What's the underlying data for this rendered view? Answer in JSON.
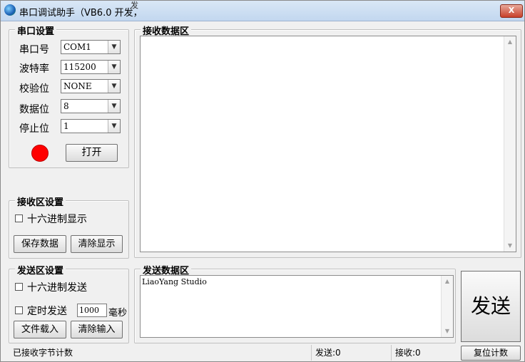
{
  "window": {
    "title": "串口调试助手（VB6.0 开发，",
    "title_extra": "发",
    "close_label": "X"
  },
  "serial_settings": {
    "legend": "串口设置",
    "port_label": "串口号",
    "port_value": "COM1",
    "baud_label": "波特率",
    "baud_value": "115200",
    "parity_label": "校验位",
    "parity_value": "NONE",
    "databits_label": "数据位",
    "databits_value": "8",
    "stopbits_label": "停止位",
    "stopbits_value": "1",
    "status_color": "#ff0000",
    "open_label": "打开"
  },
  "receive_settings": {
    "legend": "接收区设置",
    "hex_display_label": "十六进制显示",
    "save_label": "保存数据",
    "clear_label": "清除显示"
  },
  "send_settings": {
    "legend": "发送区设置",
    "hex_send_label": "十六进制发送",
    "timer_label": "定时发送",
    "interval_value": "1000",
    "unit_label": "毫秒",
    "load_file_label": "文件载入",
    "clear_input_label": "清除输入"
  },
  "receive_area": {
    "legend": "接收数据区",
    "content": ""
  },
  "send_area": {
    "legend": "发送数据区",
    "content": "LiaoYang Studio"
  },
  "send_button_label": "发送",
  "status": {
    "rx_counter_label": "已接收字节计数",
    "sent": "发送:0",
    "received": "接收:0",
    "reset_label": "复位计数"
  }
}
